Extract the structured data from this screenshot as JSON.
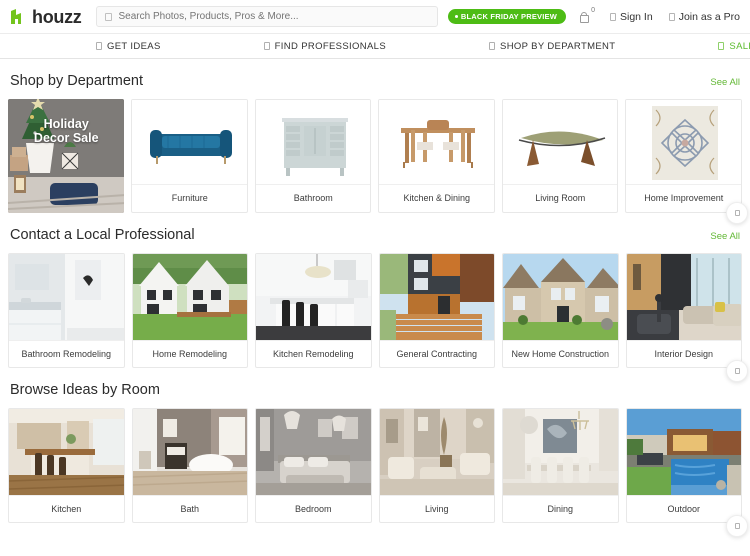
{
  "brand": {
    "name": "houzz",
    "logo_icon": "house-h-icon",
    "accent_green": "#4dbc15",
    "link_green": "#63b836"
  },
  "header": {
    "search": {
      "icon": "search-icon",
      "placeholder": "Search Photos, Products, Pros & More...",
      "value": ""
    },
    "promo_badge": {
      "label": "BLACK FRIDAY PREVIEW",
      "dot_icon": "dot-icon"
    },
    "cart": {
      "icon": "cart-icon",
      "count": "0"
    },
    "sign_in": {
      "label": "Sign In",
      "icon": "user-icon"
    },
    "join_pro": {
      "label": "Join as a Pro",
      "icon": "briefcase-icon"
    }
  },
  "nav": {
    "items": [
      {
        "label": "GET IDEAS",
        "icon": "lightbulb-icon",
        "highlight": false
      },
      {
        "label": "FIND PROFESSIONALS",
        "icon": "people-icon",
        "highlight": false
      },
      {
        "label": "SHOP BY DEPARTMENT",
        "icon": "grid-icon",
        "highlight": false
      },
      {
        "label": "SALE",
        "icon": "tag-icon",
        "highlight": true
      }
    ]
  },
  "sections": [
    {
      "title": "Shop by Department",
      "see_all": "See All",
      "feature": {
        "title_line1": "Holiday",
        "title_line2": "Decor Sale",
        "image_alt": "holiday-decor-photo"
      },
      "cards": [
        {
          "label": "Furniture",
          "image_alt": "blue-sofa-photo"
        },
        {
          "label": "Bathroom",
          "image_alt": "vanity-cabinet-photo"
        },
        {
          "label": "Kitchen & Dining",
          "image_alt": "dining-set-photo"
        },
        {
          "label": "Living Room",
          "image_alt": "coffee-table-photo"
        },
        {
          "label": "Home Improvement",
          "image_alt": "tile-pattern-photo"
        }
      ]
    },
    {
      "title": "Contact a Local Professional",
      "see_all": "See All",
      "cards": [
        {
          "label": "Bathroom Remodeling",
          "image_alt": "white-bathroom-photo"
        },
        {
          "label": "Home Remodeling",
          "image_alt": "white-houses-photo"
        },
        {
          "label": "Kitchen Remodeling",
          "image_alt": "modern-kitchen-photo"
        },
        {
          "label": "General Contracting",
          "image_alt": "modern-house-stairs-photo"
        },
        {
          "label": "New Home Construction",
          "image_alt": "suburban-house-photo"
        },
        {
          "label": "Interior Design",
          "image_alt": "open-living-space-photo"
        }
      ]
    },
    {
      "title": "Browse Ideas by Room",
      "see_all": "",
      "cards": [
        {
          "label": "Kitchen",
          "image_alt": "kitchen-island-photo"
        },
        {
          "label": "Bath",
          "image_alt": "bathtub-photo"
        },
        {
          "label": "Bedroom",
          "image_alt": "gray-bedroom-photo"
        },
        {
          "label": "Living",
          "image_alt": "formal-living-photo"
        },
        {
          "label": "Dining",
          "image_alt": "dining-room-photo"
        },
        {
          "label": "Outdoor",
          "image_alt": "pool-patio-photo"
        }
      ]
    }
  ],
  "carousel": {
    "next_icon": "chevron-right-icon"
  }
}
